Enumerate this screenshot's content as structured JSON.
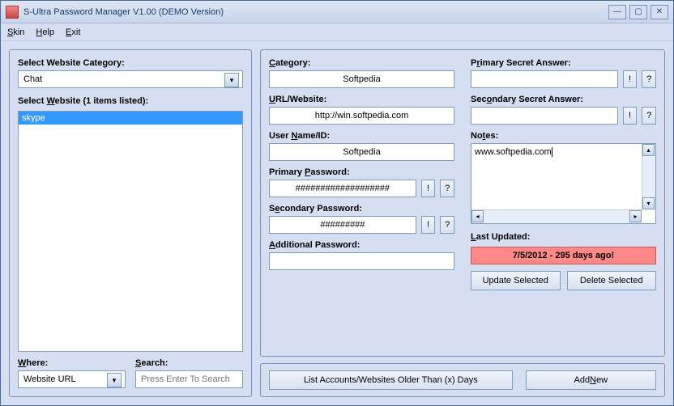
{
  "window": {
    "title": "S-Ultra Password Manager V1.00 (DEMO Version)"
  },
  "menu": {
    "skin": "Skin",
    "help": "Help",
    "exit": "Exit"
  },
  "left": {
    "category_label": "Select Website Category:",
    "category_value": "Chat",
    "website_label": "Select Website (1 items listed):",
    "list_item": "skype",
    "where_label": "Where:",
    "where_value": "Website URL",
    "search_label": "Search:",
    "search_placeholder": "Press Enter To Search"
  },
  "form": {
    "category_label": "Category:",
    "category_value": "Softpedia",
    "url_label": "URL/Website:",
    "url_value": "http://win.softpedia.com",
    "username_label": "User Name/ID:",
    "username_value": "Softpedia",
    "primary_pw_label": "Primary Password:",
    "primary_pw_value": "###################",
    "secondary_pw_label": "Secondary Password:",
    "secondary_pw_value": "#########",
    "additional_pw_label": "Additional Password:",
    "additional_pw_value": "",
    "primary_answer_label": "Primary Secret Answer:",
    "primary_answer_value": "",
    "secondary_answer_label": "Secondary Secret Answer:",
    "secondary_answer_value": "",
    "notes_label": "Notes:",
    "notes_value": "www.softpedia.com",
    "last_updated_label": "Last Updated:",
    "last_updated_value": "7/5/2012 - 295 days ago!",
    "update_btn": "Update Selected",
    "delete_btn": "Delete Selected",
    "reveal": "!",
    "help": "?"
  },
  "footer": {
    "list_old": "List Accounts/Websites Older Than (x) Days",
    "add_new": "Add New"
  }
}
